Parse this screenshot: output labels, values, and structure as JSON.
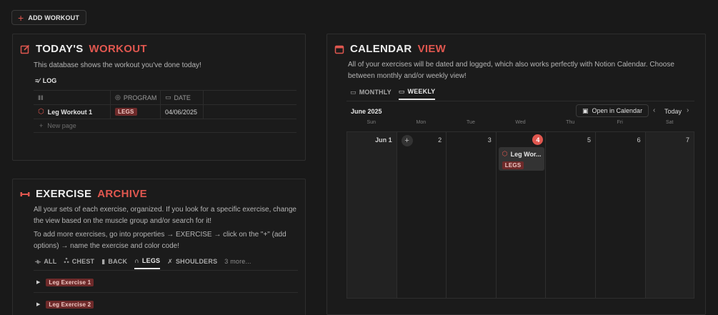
{
  "top": {
    "add_workout_label": "ADD WORKOUT"
  },
  "today": {
    "title_main": "TODAY'S",
    "title_accent": "WORKOUT",
    "description": "This database shows the workout you've done today!",
    "view_label": "LOG",
    "columns": [
      "PROGRAM",
      "DATE"
    ],
    "row": {
      "name": "Leg Workout 1",
      "program": "LEGS",
      "date": "04/06/2025"
    },
    "new_page_label": "New page"
  },
  "archive": {
    "title_main": "EXERCISE",
    "title_accent": "ARCHIVE",
    "description1": "All your sets of each exercise, organized. If you look for a specific exercise, change the view based on the muscle group and/or search for it!",
    "description2": "To add more exercises, go into properties → EXERCISE → click on the \"+\" (add options) → name the exercise and color code!",
    "tabs": [
      "ALL",
      "CHEST",
      "BACK",
      "LEGS",
      "SHOULDERS"
    ],
    "more_label": "3 more...",
    "items": [
      "Leg Exercise 1",
      "Leg Exercise 2"
    ]
  },
  "calendar": {
    "title_main": "CALENDAR",
    "title_accent": "VIEW",
    "description": "All of your exercises will be dated and logged, which also works perfectly with Notion Calendar. Choose between monthly and/or weekly view!",
    "tabs": [
      "MONTHLY",
      "WEEKLY"
    ],
    "month_label": "June 2025",
    "open_label": "Open in Calendar",
    "today_label": "Today",
    "weekdays": [
      "Sun",
      "Mon",
      "Tue",
      "Wed",
      "Thu",
      "Fri",
      "Sat"
    ],
    "days": [
      "Jun 1",
      "2",
      "3",
      "4",
      "5",
      "6",
      "7"
    ],
    "event": {
      "name": "Leg Wor...",
      "tag": "LEGS"
    }
  },
  "colors": {
    "accent": "#e0574f",
    "tag_bg": "#6e2a2a",
    "bg": "#191919"
  }
}
